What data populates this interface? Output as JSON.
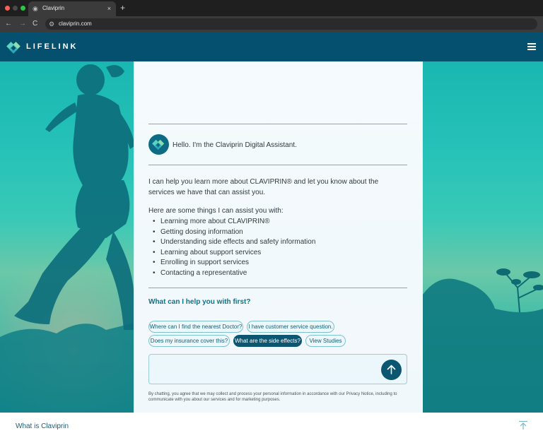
{
  "browser": {
    "tab_title": "Claviprin",
    "tab_close": "×",
    "new_tab": "+",
    "url": "claviprin.com",
    "back": "←",
    "forward": "→",
    "reload": "C"
  },
  "header": {
    "logo_text": "LIFELINK",
    "colors": {
      "header_bg": "#06506f",
      "accent": "#0c5672"
    }
  },
  "chat": {
    "greeting": "Hello. I'm the Claviprin Digital Assistant.",
    "intro": "I can help you learn more about CLAVIPRIN® and let you know about the services we have that can assist you.",
    "assist_heading": "Here are some things I can assist you with:",
    "assist_items": [
      "Learning more about CLAVIPRIN®",
      "Getting dosing information",
      "Understanding side effects and safety information",
      "Learning about support services",
      "Enrolling in support services",
      "Contacting a representative"
    ],
    "question": "What can I help you with first?",
    "suggestions": [
      "Where can I find the nearest Doctor?",
      "I have customer service question.",
      "Does my insurance  cover this?",
      "What are the side effects?",
      "View Studies"
    ],
    "active_suggestion": "What are the side effects?",
    "input_value": "",
    "disclaimer": "By chatting, you agree that we may collect and process your personal information in accordance with our Privacy Notice, including to communicate with you about our services and for marketing purposes."
  },
  "footer": {
    "link": "What is Claviprin"
  }
}
